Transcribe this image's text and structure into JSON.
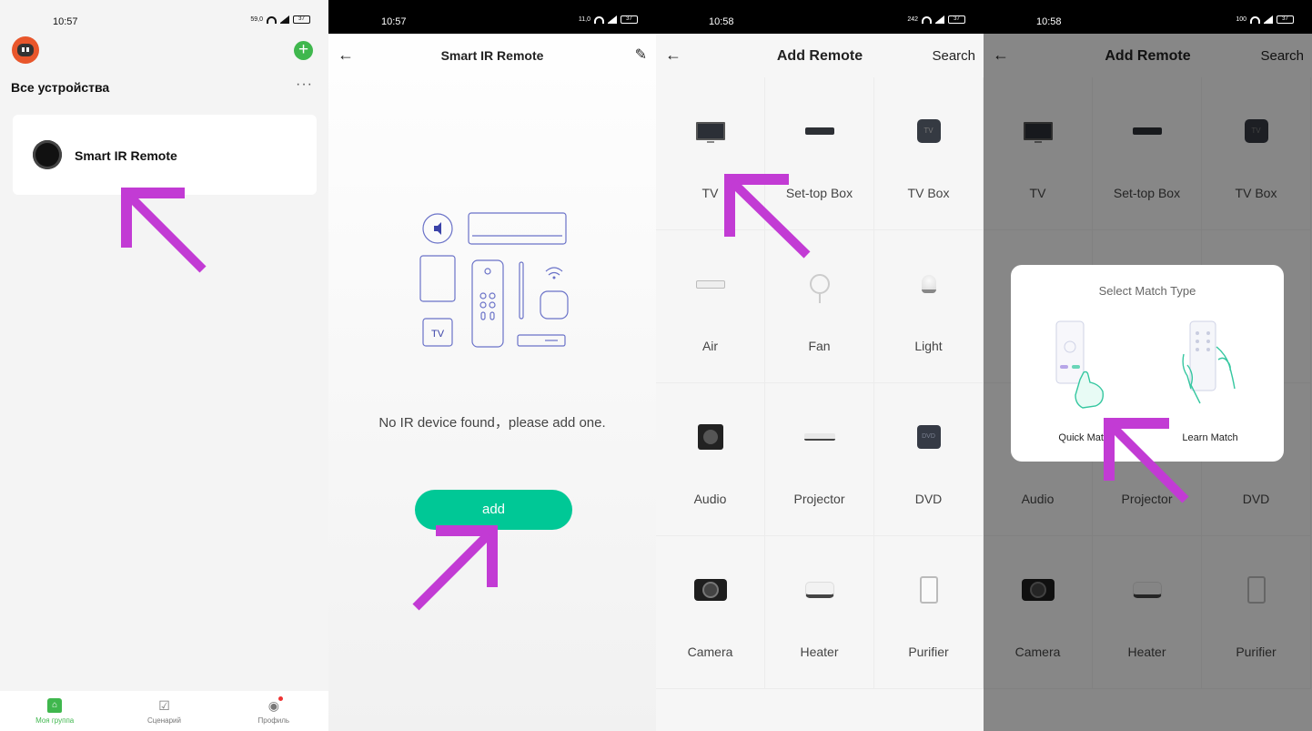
{
  "panel1": {
    "status": {
      "time": "10:57",
      "net": "59,0",
      "battery": "37"
    },
    "group_title": "Все устройства",
    "more_label": "···",
    "device": {
      "name": "Smart IR Remote"
    },
    "tabs": [
      {
        "label": "Моя группа",
        "active": true
      },
      {
        "label": "Сценарий",
        "active": false
      },
      {
        "label": "Профиль",
        "active": false
      }
    ]
  },
  "panel2": {
    "status": {
      "time": "10:57",
      "net": "11,0",
      "battery": "37"
    },
    "title": "Smart IR Remote",
    "empty_message": "No IR device found，please add one.",
    "illustration_tv_label": "TV",
    "add_label": "add"
  },
  "panel3": {
    "status": {
      "time": "10:58",
      "net": "242",
      "battery": "37"
    },
    "title": "Add Remote",
    "search_label": "Search",
    "categories": [
      {
        "label": "TV",
        "icon": "tv-icon"
      },
      {
        "label": "Set-top Box",
        "icon": "set-top-box-icon"
      },
      {
        "label": "TV Box",
        "icon": "tv-box-icon",
        "glyph": "TV"
      },
      {
        "label": "Air",
        "icon": "air-conditioner-icon"
      },
      {
        "label": "Fan",
        "icon": "fan-icon"
      },
      {
        "label": "Light",
        "icon": "light-bulb-icon"
      },
      {
        "label": "Audio",
        "icon": "audio-speaker-icon"
      },
      {
        "label": "Projector",
        "icon": "projector-icon"
      },
      {
        "label": "DVD",
        "icon": "dvd-icon",
        "glyph": "DVD"
      },
      {
        "label": "Camera",
        "icon": "camera-icon"
      },
      {
        "label": "Heater",
        "icon": "heater-icon"
      },
      {
        "label": "Purifier",
        "icon": "purifier-icon"
      }
    ]
  },
  "panel4": {
    "status": {
      "time": "10:58",
      "net": "100",
      "battery": "37"
    },
    "title": "Add Remote",
    "search_label": "Search",
    "dialog": {
      "title": "Select Match Type",
      "quick_match": "Quick Match",
      "learn_match": "Learn Match"
    }
  },
  "colors": {
    "accent_green": "#00c896",
    "tab_active": "#3fb74d",
    "annotation_arrow": "#c23bd4",
    "overlay": "rgba(0,0,0,0.45)"
  }
}
